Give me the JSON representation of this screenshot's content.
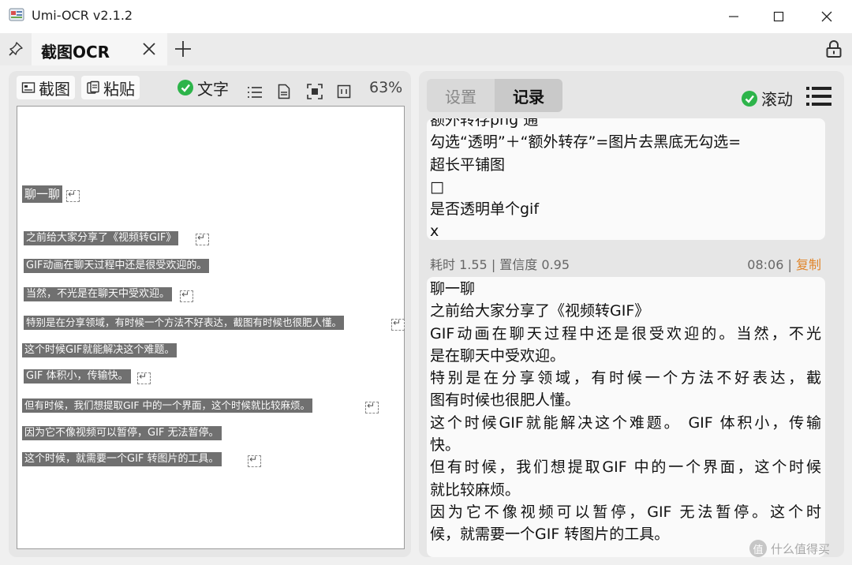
{
  "window": {
    "title": "Umi-OCR v2.1.2"
  },
  "tabs": [
    {
      "label": "截图OCR"
    }
  ],
  "left_toolbar": {
    "screenshot_label": "截图",
    "paste_label": "粘贴",
    "text_toggle_label": "文字",
    "zoom": "63%"
  },
  "ocr_preview_lines": [
    "聊一聊",
    "之前给大家分享了《视频转GIF》",
    "GIF动画在聊天过程中还是很受欢迎的。",
    "当然，不光是在聊天中受欢迎。",
    "特别是在分享领域，有时候一个方法不好表达，截图有时候也很肥人懂。",
    "这个时候GIF就能解决这个难题。",
    "GIF 体积小，传输快。",
    "但有时候，我们想提取GIF 中的一个界面，这个时候就比较麻烦。",
    "因为它不像视频可以暂停，GIF 无法暂停。",
    "这个时候，就需要一个GIF 转图片的工具。"
  ],
  "right_tabs": {
    "settings": "设置",
    "history": "记录"
  },
  "scroll_toggle_label": "滚动",
  "history": {
    "prev_record_lines": [
      "额外转存png 通",
      "勾选“透明”＋“额外转存”=图片去黑底无勾选=",
      "超长平铺图",
      "□",
      "是否透明单个gif",
      "x"
    ],
    "record_meta": {
      "elapsed": "耗时 1.55",
      "confidence": "置信度 0.95",
      "time": "08:06",
      "separator": "|",
      "copy_label": "复制"
    },
    "record_lines": [
      "聊一聊",
      "之前给大家分享了《视频转GIF》",
      "GIF动画在聊天过程中还是很受欢迎的。当然，不光",
      "是在聊天中受欢迎。",
      "特别是在分享领域，有时候一个方法不好表达，截",
      "图有时候也很肥人懂。",
      "这个时候GIF就能解决这个难题。 GIF 体积小，传输",
      "快。",
      "但有时候，我们想提取GIF 中的一个界面，这个时候",
      "就比较麻烦。",
      "因为它不像视频可以暂停，GIF 无法暂停。这个时",
      "候，就需要一个GIF 转图片的工具。"
    ]
  },
  "watermark": "什么值得买",
  "colors": {
    "check_green": "#2db44a",
    "copy_orange": "#e0852a",
    "ocr_box": "#707070"
  }
}
